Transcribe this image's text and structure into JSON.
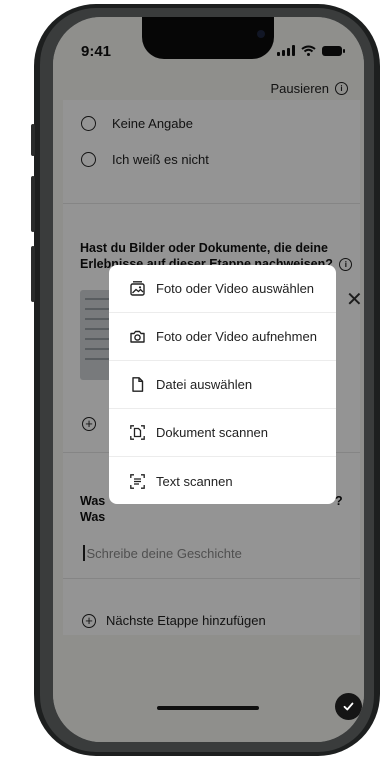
{
  "status": {
    "time": "9:41"
  },
  "header": {
    "pause_label": "Pausieren",
    "pause_info_icon": "info-icon"
  },
  "options": [
    {
      "label": "Keine Angabe"
    },
    {
      "label": "Ich weiß es nicht"
    }
  ],
  "documents": {
    "question": "Hast du Bilder oder Dokumente, die deine Erlebnisse auf dieser Etappe nachweisen?",
    "close_icon": "close-icon"
  },
  "story": {
    "question_line1": "Was",
    "question_line2": "Was",
    "question_mark": "?",
    "placeholder": "Schreibe deine Geschichte"
  },
  "next_stage": {
    "label": "Nächste Etappe hinzufügen"
  },
  "sheet": {
    "items": [
      {
        "label": "Foto oder Video auswählen",
        "icon": "photo-library-icon"
      },
      {
        "label": "Foto oder Video aufnehmen",
        "icon": "camera-icon"
      },
      {
        "label": "Datei auswählen",
        "icon": "file-icon"
      },
      {
        "label": "Dokument scannen",
        "icon": "document-scan-icon"
      },
      {
        "label": "Text scannen",
        "icon": "text-scan-icon"
      }
    ]
  },
  "colors": {
    "overlay": "#000000",
    "accent": "#151515"
  }
}
